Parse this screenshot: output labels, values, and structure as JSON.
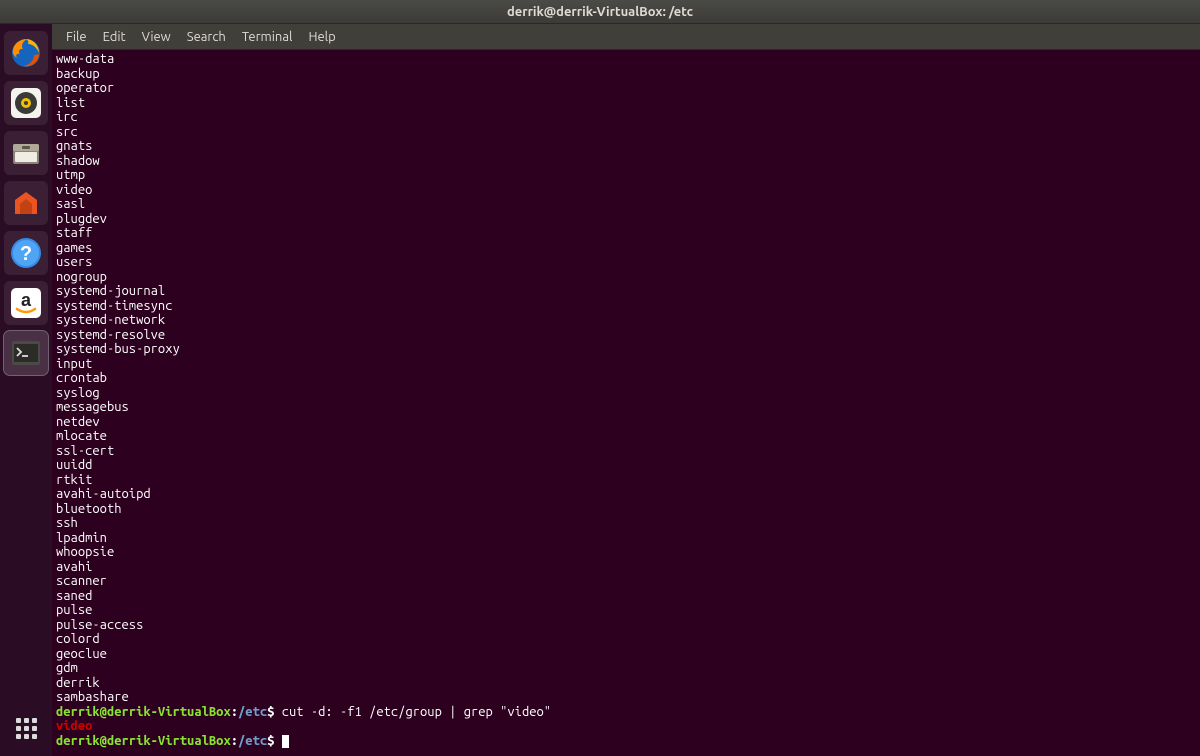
{
  "titlebar": {
    "title": "derrik@derrik-VirtualBox: /etc"
  },
  "menubar": {
    "items": [
      "File",
      "Edit",
      "View",
      "Search",
      "Terminal",
      "Help"
    ]
  },
  "launcher": {
    "items": [
      {
        "name": "firefox-icon"
      },
      {
        "name": "music-icon"
      },
      {
        "name": "files-icon"
      },
      {
        "name": "software-center-icon"
      },
      {
        "name": "help-icon"
      },
      {
        "name": "amazon-icon"
      },
      {
        "name": "terminal-icon",
        "active": true
      }
    ]
  },
  "terminal": {
    "output_lines": [
      "www-data",
      "backup",
      "operator",
      "list",
      "irc",
      "src",
      "gnats",
      "shadow",
      "utmp",
      "video",
      "sasl",
      "plugdev",
      "staff",
      "games",
      "users",
      "nogroup",
      "systemd-journal",
      "systemd-timesync",
      "systemd-network",
      "systemd-resolve",
      "systemd-bus-proxy",
      "input",
      "crontab",
      "syslog",
      "messagebus",
      "netdev",
      "mlocate",
      "ssl-cert",
      "uuidd",
      "rtkit",
      "avahi-autoipd",
      "bluetooth",
      "ssh",
      "lpadmin",
      "whoopsie",
      "avahi",
      "scanner",
      "saned",
      "pulse",
      "pulse-access",
      "colord",
      "geoclue",
      "gdm",
      "derrik",
      "sambashare"
    ],
    "prompt": {
      "user_host": "derrik@derrik-VirtualBox",
      "path": "/etc",
      "sep": ":",
      "sigil": "$"
    },
    "command1": " cut -d: -f1 /etc/group | grep \"video\"",
    "grep_result": "video",
    "command2": " "
  }
}
